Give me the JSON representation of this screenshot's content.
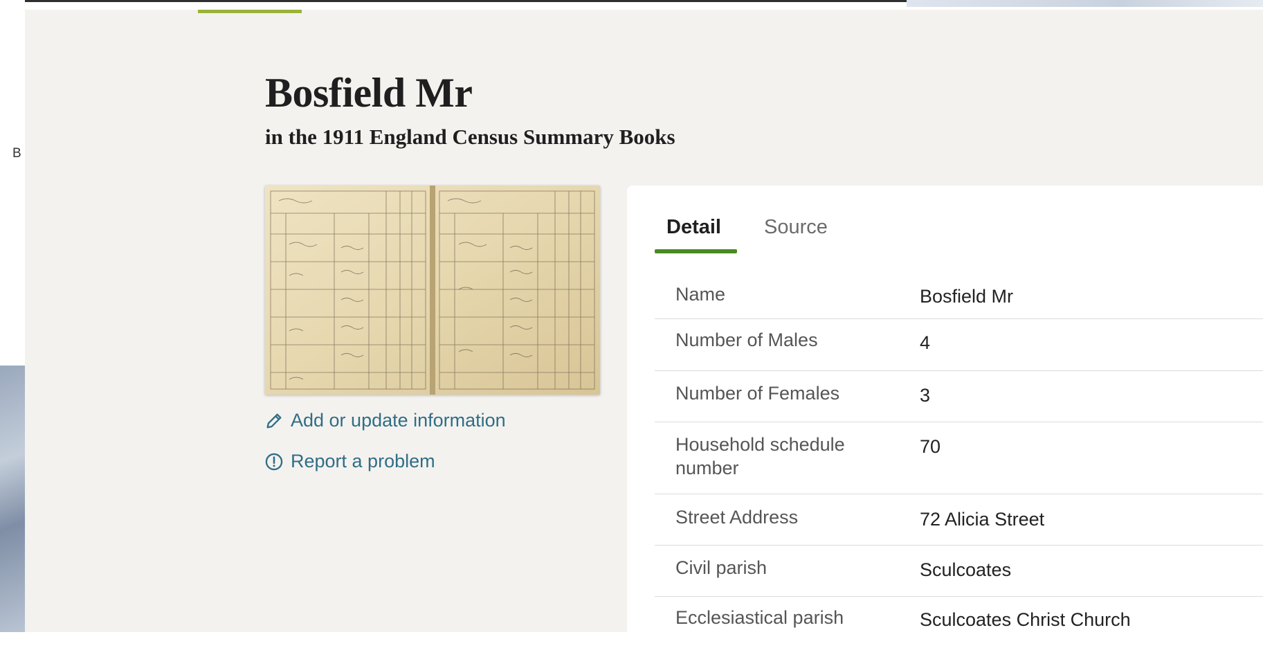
{
  "backdrop": {
    "left_text": "B"
  },
  "record": {
    "title": "Bosfield Mr",
    "collection": "in the 1911 England Census Summary Books"
  },
  "actions": {
    "update_label": "Add or update information",
    "report_label": "Report a problem"
  },
  "tabs": [
    {
      "label": "Detail",
      "active": true
    },
    {
      "label": "Source",
      "active": false
    }
  ],
  "details": [
    {
      "label": "Name",
      "value": "Bosfield Mr"
    },
    {
      "label": "Number of Males",
      "value": "4"
    },
    {
      "label": "Number of Females",
      "value": "3"
    },
    {
      "label": "Household schedule number",
      "value": "70"
    },
    {
      "label": "Street Address",
      "value": "72 Alicia Street"
    },
    {
      "label": "Civil parish",
      "value": "Sculcoates"
    },
    {
      "label": "Ecclesiastical parish",
      "value": "Sculcoates Christ Church"
    }
  ],
  "colors": {
    "background": "#f4f2ef",
    "link": "#2f6e86",
    "tab_accent": "#4a8a23",
    "nav_accent": "#9bb33a"
  }
}
